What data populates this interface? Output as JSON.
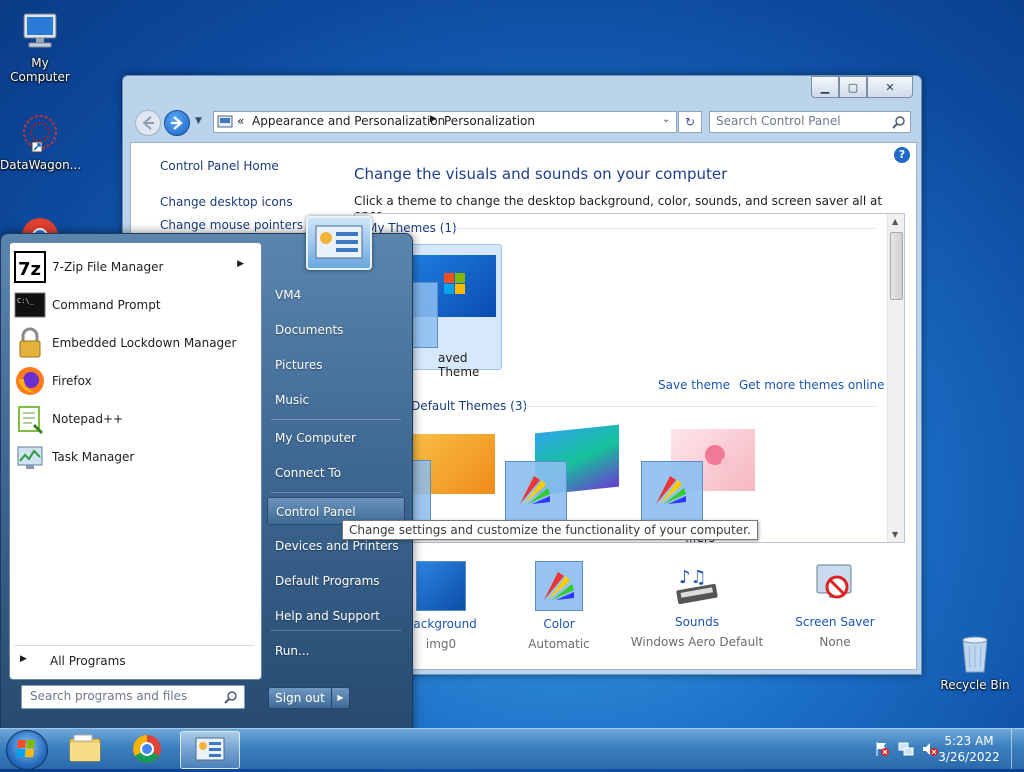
{
  "desktop": {
    "icons": [
      {
        "label": "My Computer",
        "icon": "computer-icon"
      },
      {
        "label": "DataWagon...",
        "icon": "datawagon-icon"
      },
      {
        "label": "Recycle Bin",
        "icon": "recycle-bin-icon"
      }
    ]
  },
  "window": {
    "address": {
      "chevron": "«",
      "crumbs": [
        "Appearance and Personalization",
        "Personalization"
      ]
    },
    "search_placeholder": "Search Control Panel",
    "left_links": [
      "Control Panel Home",
      "Change desktop icons",
      "Change mouse pointers"
    ],
    "heading": "Change the visuals and sounds on your computer",
    "subtext": "Click a theme to change the desktop background, color, sounds, and screen saver all at once.",
    "my_themes_title": "My Themes (1)",
    "saved_theme_label": "aved Theme",
    "save_theme": "Save theme",
    "get_more_themes": "Get more themes online",
    "default_themes_title": "s Default Themes (3)",
    "default_theme_labels": [
      "...",
      "...",
      "...ers"
    ],
    "bottom": [
      {
        "title": "Background",
        "sub": "img0",
        "icon": "desktop-background-icon"
      },
      {
        "title": "Color",
        "sub": "Automatic",
        "icon": "color-icon"
      },
      {
        "title": "Sounds",
        "sub": "Windows Aero Default",
        "icon": "sounds-icon"
      },
      {
        "title": "Screen Saver",
        "sub": "None",
        "icon": "screen-saver-icon"
      }
    ]
  },
  "start_menu": {
    "programs": [
      {
        "label": "7-Zip File Manager",
        "icon": "7zip-icon",
        "has_arrow": true
      },
      {
        "label": "Command Prompt",
        "icon": "command-prompt-icon"
      },
      {
        "label": "Embedded Lockdown Manager",
        "icon": "lockdown-icon"
      },
      {
        "label": "Firefox",
        "icon": "firefox-icon"
      },
      {
        "label": "Notepad++",
        "icon": "notepad-plus-plus-icon"
      },
      {
        "label": "Task Manager",
        "icon": "task-manager-icon"
      }
    ],
    "all_programs": "All Programs",
    "search_placeholder": "Search programs and files",
    "right_items": [
      "VM4",
      "Documents",
      "Pictures",
      "Music",
      "My Computer",
      "Connect To",
      "Control Panel",
      "Devices and Printers",
      "Default Programs",
      "Help and Support",
      "Run..."
    ],
    "selected_item": "Control Panel",
    "sign_out": "Sign out",
    "tooltip": "Change settings and customize the functionality of your computer."
  },
  "taskbar": {
    "time": "5:23 AM",
    "date": "3/26/2022"
  }
}
